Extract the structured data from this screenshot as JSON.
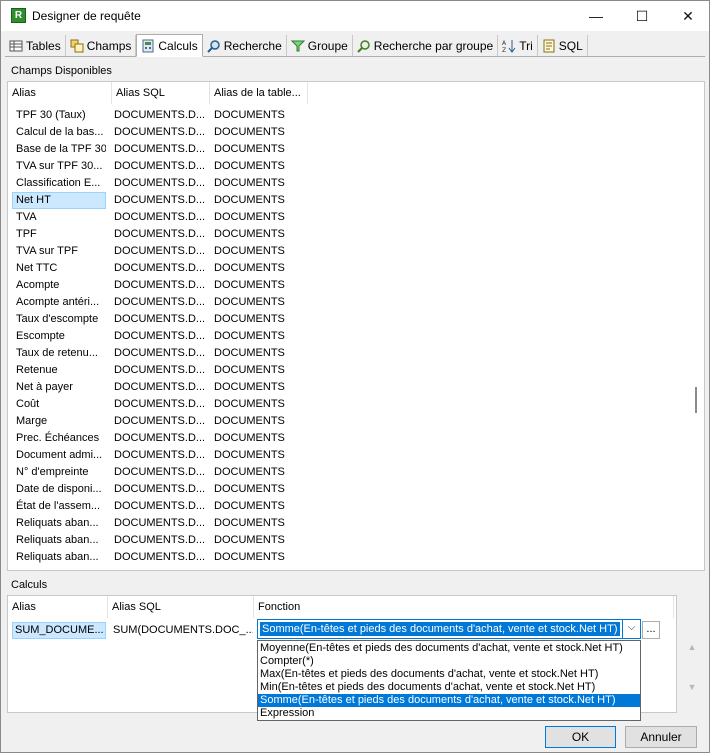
{
  "window": {
    "title": "Designer de requête",
    "controls": {
      "minimize": "—",
      "maximize": "☐",
      "close": "✕"
    }
  },
  "tabs": [
    {
      "label": "Tables",
      "icon": "table-icon"
    },
    {
      "label": "Champs",
      "icon": "fields-icon"
    },
    {
      "label": "Calculs",
      "icon": "calculator-icon",
      "active": true
    },
    {
      "label": "Recherche",
      "icon": "magnifier-icon"
    },
    {
      "label": "Groupe",
      "icon": "funnel-icon"
    },
    {
      "label": "Recherche par groupe",
      "icon": "magnifier-group-icon"
    },
    {
      "label": "Tri",
      "icon": "sort-az-icon"
    },
    {
      "label": "SQL",
      "icon": "sql-icon"
    }
  ],
  "champs": {
    "section_label": "Champs Disponibles",
    "columns": [
      "Alias",
      "Alias SQL",
      "Alias de la table..."
    ],
    "rows": [
      [
        "TPF 30 (Taux)",
        "DOCUMENTS.D...",
        "DOCUMENTS"
      ],
      [
        "Calcul de la bas...",
        "DOCUMENTS.D...",
        "DOCUMENTS"
      ],
      [
        "Base de la TPF 30",
        "DOCUMENTS.D...",
        "DOCUMENTS"
      ],
      [
        "TVA sur TPF 30...",
        "DOCUMENTS.D...",
        "DOCUMENTS"
      ],
      [
        "Classification E...",
        "DOCUMENTS.D...",
        "DOCUMENTS"
      ],
      [
        "Net HT",
        "DOCUMENTS.D...",
        "DOCUMENTS"
      ],
      [
        "TVA",
        "DOCUMENTS.D...",
        "DOCUMENTS"
      ],
      [
        "TPF",
        "DOCUMENTS.D...",
        "DOCUMENTS"
      ],
      [
        "TVA sur TPF",
        "DOCUMENTS.D...",
        "DOCUMENTS"
      ],
      [
        "Net TTC",
        "DOCUMENTS.D...",
        "DOCUMENTS"
      ],
      [
        "Acompte",
        "DOCUMENTS.D...",
        "DOCUMENTS"
      ],
      [
        "Acompte antéri...",
        "DOCUMENTS.D...",
        "DOCUMENTS"
      ],
      [
        "Taux d'escompte",
        "DOCUMENTS.D...",
        "DOCUMENTS"
      ],
      [
        "Escompte",
        "DOCUMENTS.D...",
        "DOCUMENTS"
      ],
      [
        "Taux de retenu...",
        "DOCUMENTS.D...",
        "DOCUMENTS"
      ],
      [
        "Retenue",
        "DOCUMENTS.D...",
        "DOCUMENTS"
      ],
      [
        "Net à payer",
        "DOCUMENTS.D...",
        "DOCUMENTS"
      ],
      [
        "Coût",
        "DOCUMENTS.D...",
        "DOCUMENTS"
      ],
      [
        "Marge",
        "DOCUMENTS.D...",
        "DOCUMENTS"
      ],
      [
        "Prec. Échéances",
        "DOCUMENTS.D...",
        "DOCUMENTS"
      ],
      [
        "Document admi...",
        "DOCUMENTS.D...",
        "DOCUMENTS"
      ],
      [
        "N° d'empreinte",
        "DOCUMENTS.D...",
        "DOCUMENTS"
      ],
      [
        "Date de disponi...",
        "DOCUMENTS.D...",
        "DOCUMENTS"
      ],
      [
        "État de l'assem...",
        "DOCUMENTS.D...",
        "DOCUMENTS"
      ],
      [
        "Reliquats aban...",
        "DOCUMENTS.D...",
        "DOCUMENTS"
      ],
      [
        "Reliquats aban...",
        "DOCUMENTS.D...",
        "DOCUMENTS"
      ],
      [
        "Reliquats aban...",
        "DOCUMENTS.D...",
        "DOCUMENTS"
      ]
    ],
    "selected_index": 5
  },
  "calculs": {
    "section_label": "Calculs",
    "columns": [
      "Alias",
      "Alias SQL",
      "Fonction"
    ],
    "row": {
      "alias": "SUM_DOCUME...",
      "alias_sql": "SUM(DOCUMENTS.DOC_...",
      "fonction": "Somme(En-têtes et pieds des documents d'achat, vente et stock.Net HT)"
    },
    "combo_arrow": "⌵",
    "ellipsis_label": "...",
    "options": [
      "Moyenne(En-têtes et pieds des documents d'achat, vente et stock.Net HT)",
      "Compter(*)",
      "Max(En-têtes et pieds des documents d'achat, vente et stock.Net HT)",
      "Min(En-têtes et pieds des documents d'achat, vente et stock.Net HT)",
      "Somme(En-têtes et pieds des documents d'achat, vente et stock.Net HT)",
      "Expression"
    ],
    "selected_option": 4
  },
  "buttons": {
    "ok": "OK",
    "cancel": "Annuler"
  }
}
